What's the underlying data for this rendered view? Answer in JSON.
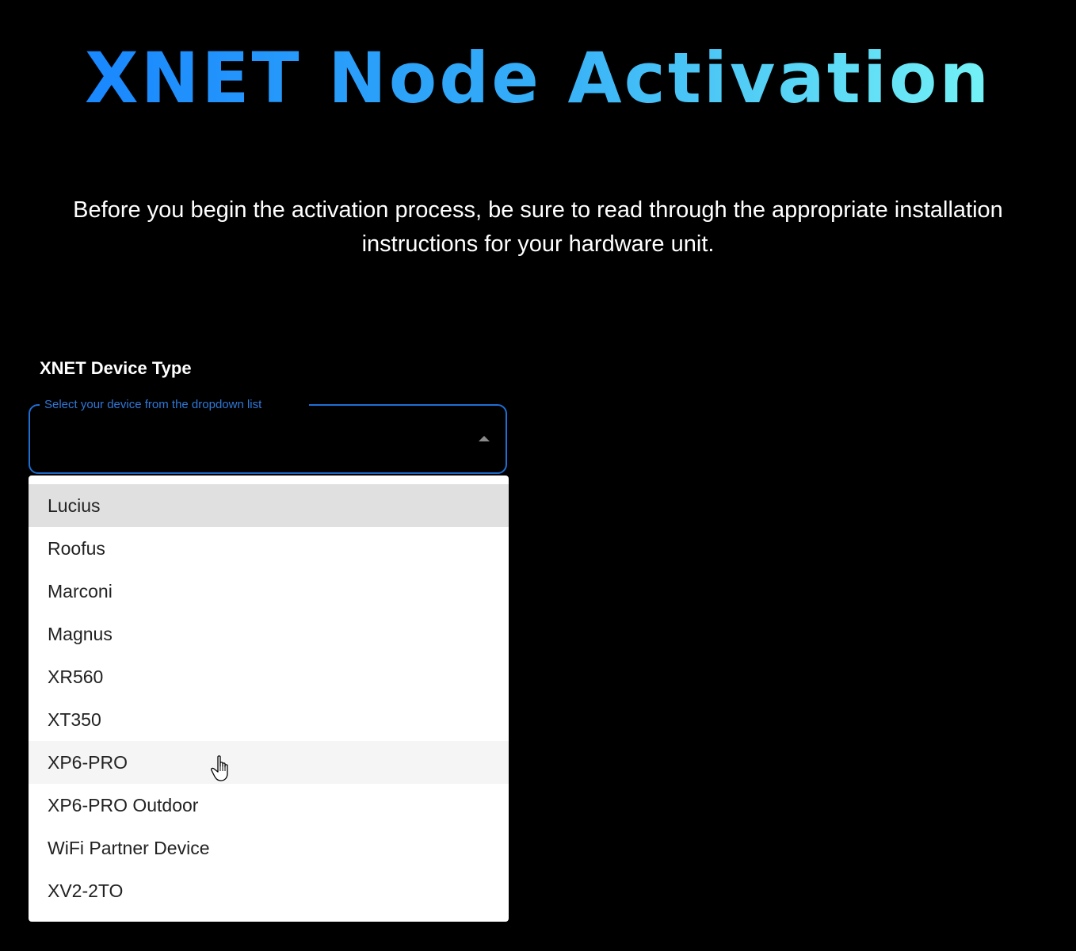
{
  "header": {
    "title": "XNET Node Activation"
  },
  "intro": {
    "text": "Before you begin the activation process, be sure to read through the appropriate installation instructions for your hardware unit."
  },
  "device_field": {
    "label": "XNET Device Type",
    "placeholder": "Select your device from the dropdown list",
    "selected_value": "",
    "expanded": true
  },
  "dropdown": {
    "options": [
      "Lucius",
      "Roofus",
      "Marconi",
      "Magnus",
      "XR560",
      "XT350",
      "XP6-PRO",
      "XP6-PRO Outdoor",
      "WiFi Partner Device",
      "XV2-2TO"
    ],
    "highlighted_option": "Lucius",
    "hovered_option": "XP6-PRO"
  },
  "colors": {
    "background": "#000000",
    "title_gradient_start": "#1480ff",
    "title_gradient_end": "#7ffff5",
    "accent": "#1e6fd6",
    "menu_background": "#ffffff",
    "selected_item": "#e0e0e0",
    "hovered_item": "#f5f5f5"
  },
  "icons": {
    "caret": "caret-up-icon",
    "cursor": "hand-pointer-icon"
  }
}
